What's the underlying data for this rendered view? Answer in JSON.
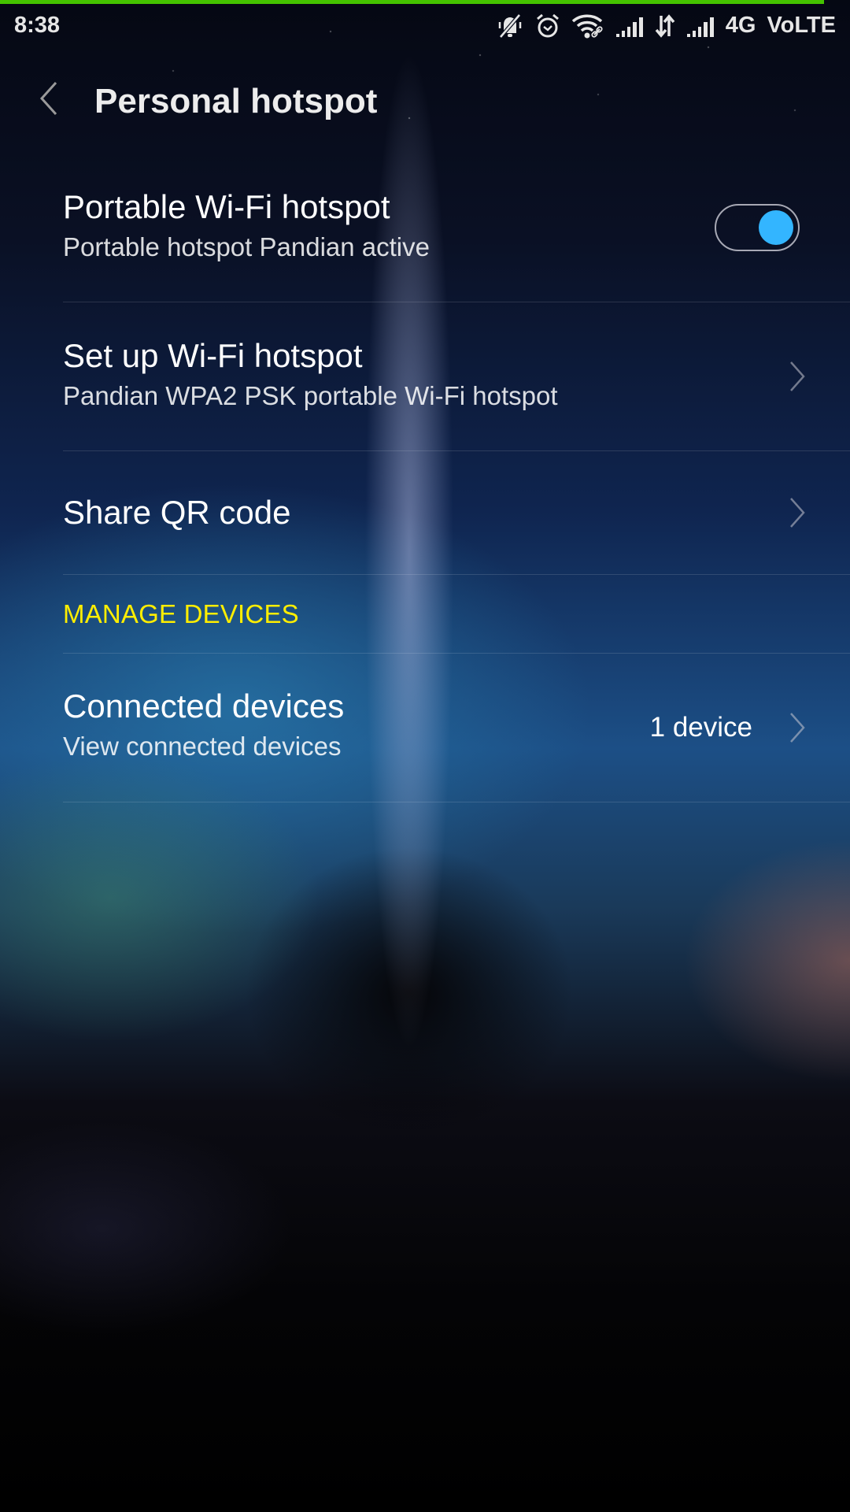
{
  "colors": {
    "accent_bar": "#44c200",
    "toggle_on": "#33b5ff",
    "section_header": "#ffee00"
  },
  "status_bar": {
    "time": "8:38",
    "icons": [
      "bell-muted-icon",
      "alarm-clock-icon",
      "wifi-hotspot-icon",
      "signal-strength-icon",
      "data-transfer-icon",
      "signal-strength-icon"
    ],
    "network_label": "4G",
    "volte_label": "VoLTE"
  },
  "header": {
    "back_icon": "chevron-left-icon",
    "title": "Personal hotspot"
  },
  "items": {
    "portable_hotspot": {
      "title": "Portable Wi-Fi hotspot",
      "subtitle": "Portable hotspot Pandian active",
      "toggle_on": true
    },
    "setup_hotspot": {
      "title": "Set up Wi-Fi hotspot",
      "subtitle": "Pandian WPA2 PSK portable Wi-Fi hotspot"
    },
    "share_qr": {
      "title": "Share QR code"
    },
    "manage_devices_header": "MANAGE DEVICES",
    "connected_devices": {
      "title": "Connected devices",
      "subtitle": "View connected devices",
      "value": "1 device"
    }
  }
}
